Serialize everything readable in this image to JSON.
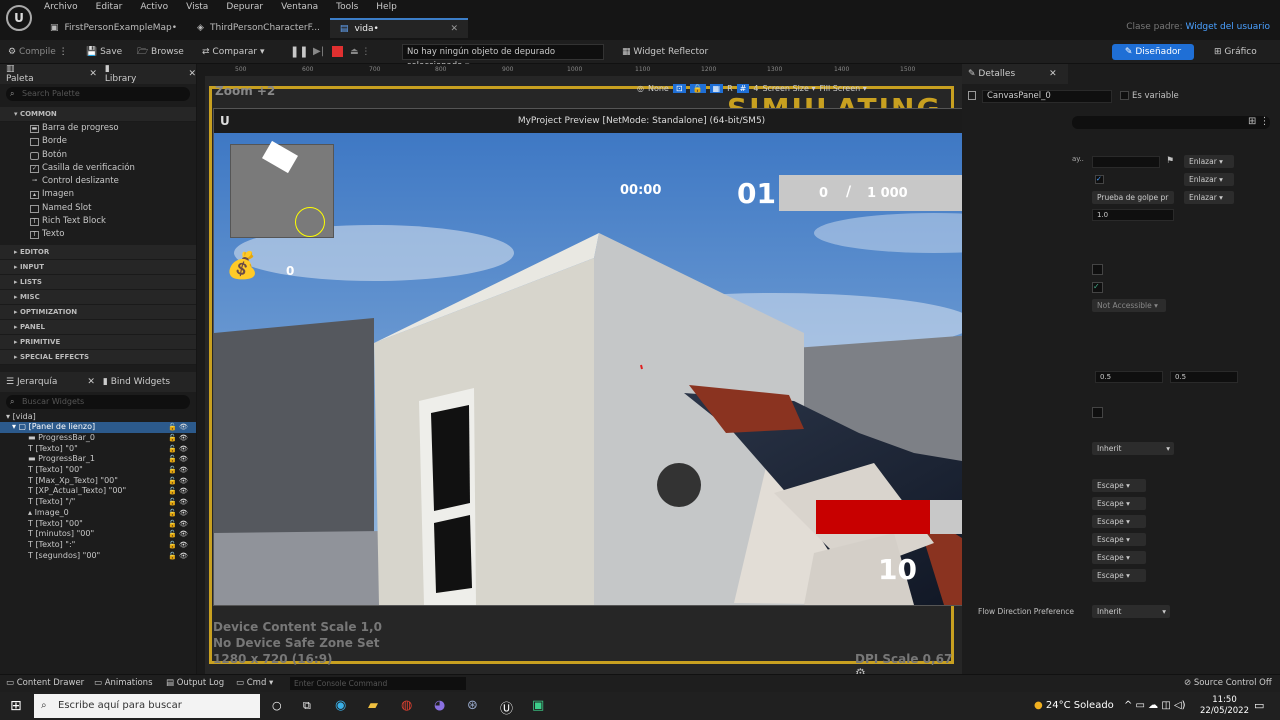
{
  "menubar": {
    "items": [
      "Archivo",
      "Editar",
      "Activo",
      "Vista",
      "Depurar",
      "Ventana",
      "Tools",
      "Help"
    ],
    "tabs": [
      {
        "label": "FirstPersonExampleMap•"
      },
      {
        "label": "ThirdPersonCharacterF..."
      },
      {
        "label": "vida•"
      }
    ],
    "parent_class_label": "Clase padre:",
    "parent_class_value": "Widget del usuario"
  },
  "toolbar": {
    "compile": "Compile",
    "save": "Save",
    "browse": "Browse",
    "compare": "Comparar",
    "debug_select": "No hay ningún objeto de depurado seleccionado",
    "widget_reflector": "Widget Reflector",
    "designer": "Diseñador",
    "graph": "Gráfico"
  },
  "palette": {
    "tab": "Paleta",
    "library_tab": "Library",
    "search_placeholder": "Search Palette",
    "common_label": "COMMON",
    "common_items": [
      "Barra de progreso",
      "Borde",
      "Botón",
      "Casilla de verificación",
      "Control deslizante",
      "Imagen",
      "Named Slot",
      "Rich Text Block",
      "Texto"
    ],
    "categories": [
      "EDITOR",
      "INPUT",
      "LISTS",
      "MISC",
      "OPTIMIZATION",
      "PANEL",
      "PRIMITIVE",
      "SPECIAL EFFECTS"
    ]
  },
  "hierarchy": {
    "tab": "Jerarquía",
    "bind_tab": "Bind Widgets",
    "search_placeholder": "Buscar Widgets",
    "root": "[vida]",
    "canvas": "[Panel de lienzo]",
    "items": [
      "ProgressBar_0",
      "[Texto] \"0\"",
      "ProgressBar_1",
      "[Texto] \"00\"",
      "[Max_Xp_Texto] \"00\"",
      "[XP_Actual_Texto] \"00\"",
      "[Texto] \"/\"",
      "Image_0",
      "[Texto] \"00\"",
      "[minutos] \"00\"",
      "[Texto] \":\"",
      "[segundos] \"00\""
    ]
  },
  "designer": {
    "zoom": "Zoom +2",
    "ruler": [
      "500",
      "600",
      "700",
      "800",
      "900",
      "1000",
      "1100",
      "1200",
      "1300",
      "1400",
      "1500"
    ],
    "none": "None",
    "r": "R",
    "four": "4",
    "screen_size": "Screen Size",
    "fill_screen": "Fill Screen",
    "simulating": "SIMULATING",
    "device_scale": "Device Content Scale 1,0",
    "safe_zone": "No Device Safe Zone Set",
    "resolution": "1280 x 720 (16:9)",
    "dpi": "DPI Scale 0,67"
  },
  "preview": {
    "title": "MyProject Preview [NetMode: Standalone]  (64-bit/SM5)",
    "timer": "00:00",
    "level": "01",
    "xp_current": "0",
    "xp_slash": "/",
    "xp_max": "1 000",
    "coins": "0",
    "ammo": "10",
    "health_fraction": 0.73
  },
  "details": {
    "tab": "Detalles",
    "name": "CanvasPanel_0",
    "is_variable": "Es variable",
    "enlazar": "Enlazar",
    "hit_test": "Prueba de golpe pr",
    "value_1": "1.0",
    "not_accessible": "Not Accessible",
    "pivot_x": "0.5",
    "pivot_y": "0.5",
    "inherit": "Inherit",
    "escape": "Escape",
    "flow_label": "Flow Direction Preference",
    "flow_value": "Inherit",
    "partial": "ay.."
  },
  "bottombar": {
    "content_drawer": "Content Drawer",
    "animations": "Animations",
    "output_log": "Output Log",
    "cmd": "Cmd",
    "console_placeholder": "Enter Console Command",
    "source_control": "Source Control Off"
  },
  "taskbar": {
    "search_placeholder": "Escribe aquí para buscar",
    "weather": "24°C  Soleado",
    "time": "11:50",
    "date": "22/05/2022"
  },
  "colors": {
    "accent": "#1f6fd6",
    "health": "#c80000",
    "orange_frame": "#c8a020"
  }
}
